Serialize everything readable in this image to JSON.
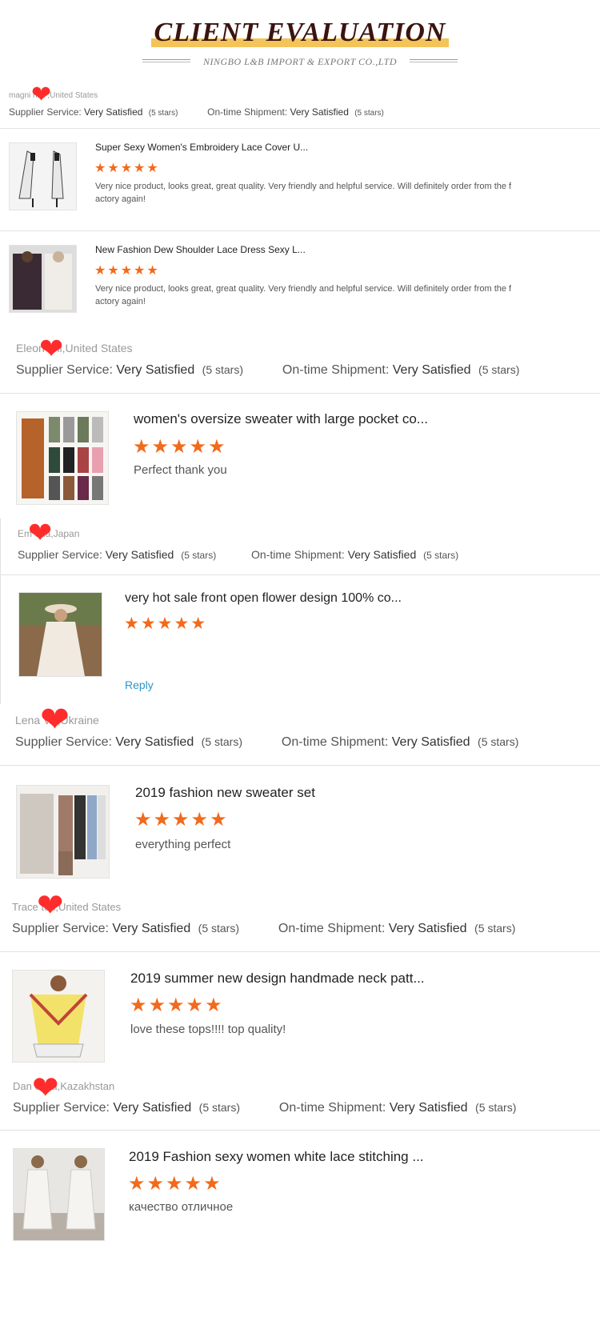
{
  "header": {
    "title": "CLIENT EVALUATION",
    "subtitle": "NINGBO L&B IMPORT & EXPORT CO.,LTD"
  },
  "labels": {
    "supplier_service": "Supplier Service: ",
    "ontime_shipment": "On-time Shipment: ",
    "rating_text": "Very Satisfied",
    "stars_text": "(5 stars)",
    "star_glyphs": "★★★★★",
    "heart_glyph": "❤",
    "reply": "Reply"
  },
  "colors": {
    "accent_yellow": "#f2c45a",
    "title_dark": "#3b1410",
    "star_orange": "#f26a1b",
    "heart_red": "#ff2c2c",
    "reply_blue": "#2e93c9"
  },
  "reviews": [
    {
      "buyer": "magni        hini ,United States",
      "products": [
        {
          "title": "Super Sexy Women's Embroidery Lace Cover U...",
          "rating": 5,
          "comment": "Very nice product, looks great, great quality. Very friendly and helpful service. Will definitely order from the f actory again!"
        },
        {
          "title": "New Fashion Dew Shoulder Lace Dress Sexy L...",
          "rating": 5,
          "comment": "Very nice product, looks great, great quality. Very friendly and helpful service. Will definitely order from the f actory again!"
        }
      ]
    },
    {
      "buyer": "Eleon          fini,United States",
      "products": [
        {
          "title": "women's oversize sweater with large pocket co...",
          "rating": 5,
          "comment": "Perfect thank you"
        }
      ]
    },
    {
      "buyer": "Em          eda,Japan",
      "products": [
        {
          "title": "very hot sale front open flower design 100% co...",
          "rating": 5,
          "comment": ""
        }
      ]
    },
    {
      "buyer": "Lena           VA,Ukraine",
      "products": [
        {
          "title": "2019 fashion new sweater set",
          "rating": 5,
          "comment": "everything perfect"
        }
      ]
    },
    {
      "buyer": "Trace          ton,United States",
      "products": [
        {
          "title": "2019 summer new design handmade neck patt...",
          "rating": 5,
          "comment": "love these tops!!!! top quality!"
        }
      ]
    },
    {
      "buyer": "Dan          ovna,Kazakhstan",
      "products": [
        {
          "title": "2019 Fashion sexy women white lace stitching ...",
          "rating": 5,
          "comment": "качество отличное"
        }
      ]
    }
  ]
}
